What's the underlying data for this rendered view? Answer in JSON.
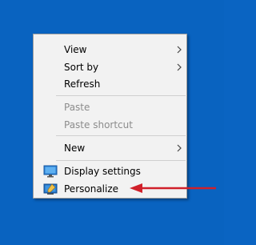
{
  "context_menu": {
    "items": [
      {
        "label": "View",
        "has_submenu": true,
        "disabled": false
      },
      {
        "label": "Sort by",
        "has_submenu": true,
        "disabled": false
      },
      {
        "label": "Refresh",
        "has_submenu": false,
        "disabled": false
      },
      {
        "label": "Paste",
        "has_submenu": false,
        "disabled": true
      },
      {
        "label": "Paste shortcut",
        "has_submenu": false,
        "disabled": true
      },
      {
        "label": "New",
        "has_submenu": true,
        "disabled": false
      },
      {
        "label": "Display settings",
        "has_submenu": false,
        "disabled": false,
        "icon": "display-icon"
      },
      {
        "label": "Personalize",
        "has_submenu": false,
        "disabled": false,
        "icon": "personalize-icon"
      }
    ]
  },
  "annotation": {
    "arrow_icon": "red-arrow-icon",
    "arrow_color": "#d0202a"
  },
  "colors": {
    "desktop_background": "#0963c0",
    "menu_background": "#f2f2f2",
    "disabled_text": "#8c8c8c"
  }
}
